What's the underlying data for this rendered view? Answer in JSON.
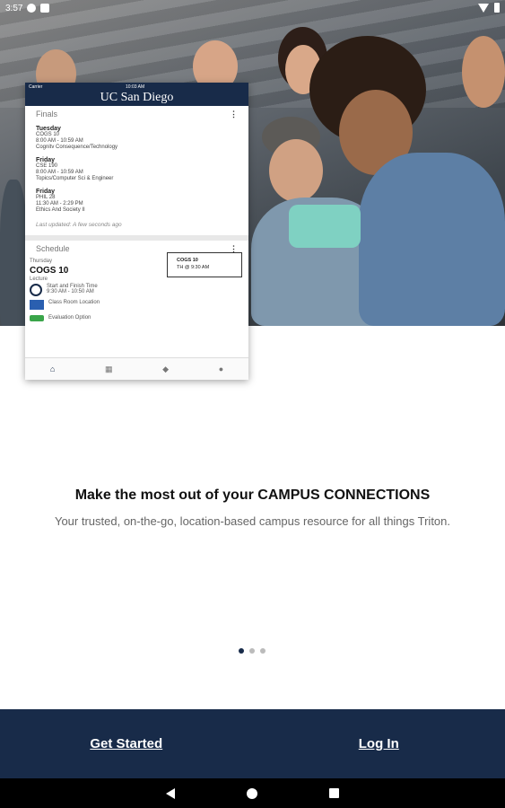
{
  "status_bar": {
    "time": "3:57"
  },
  "phone_mockup": {
    "carrier": "Carrier",
    "clock": "10:03 AM",
    "logo": "UC San Diego",
    "finals": {
      "title": "Finals",
      "menu": "⋮",
      "items": [
        {
          "day": "Tuesday",
          "course": "COGS 10",
          "time": "8:00 AM - 10:59 AM",
          "name": "Cognitv Consequence/Technology"
        },
        {
          "day": "Friday",
          "course": "CSE 190",
          "time": "8:00 AM - 10:59 AM",
          "name": "Topics/Computer Sci & Engineer"
        },
        {
          "day": "Friday",
          "course": "PHIL 28",
          "time": "11:30 AM - 2:29 PM",
          "name": "Ethics And Society II"
        }
      ],
      "updated": "Last updated: A few seconds ago"
    },
    "schedule": {
      "title": "Schedule",
      "menu": "⋮",
      "day": "Thursday",
      "course": "COGS 10",
      "type": "Lecture",
      "start_finish_label": "Start and Finish Time",
      "time": "9:30 AM - 10:50 AM",
      "location_label": "Class Room Location",
      "evaluation_label": "Evaluation Option",
      "tooltip_course": "COGS 10",
      "tooltip_time": "TH @ 9:30 AM"
    }
  },
  "onboarding": {
    "headline": "Make the most out of your CAMPUS CONNECTIONS",
    "subline": "Your trusted, on-the-go, location-based campus resource for all things Triton.",
    "page_count": 3,
    "active_page": 1
  },
  "actions": {
    "get_started": "Get Started",
    "log_in": "Log In"
  },
  "colors": {
    "brand_navy": "#182b49",
    "text_dark": "#111111",
    "text_muted": "#666666"
  }
}
